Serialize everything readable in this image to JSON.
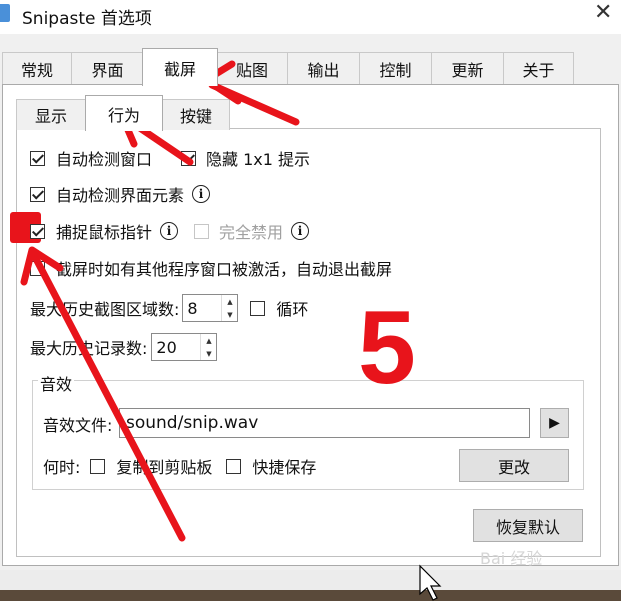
{
  "window": {
    "title": "Snipaste 首选项",
    "close_glyph": "✕"
  },
  "tabs": [
    "常规",
    "界面",
    "截屏",
    "贴图",
    "输出",
    "控制",
    "更新",
    "关于"
  ],
  "active_tab": "截屏",
  "subtabs": [
    "显示",
    "行为",
    "按键"
  ],
  "active_subtab": "行为",
  "options": {
    "auto_detect_window": {
      "label": "自动检测窗口",
      "checked": true
    },
    "hide_1x1_hint": {
      "label": "隐藏 1x1 提示",
      "checked": true
    },
    "auto_detect_elements": {
      "label": "自动检测界面元素",
      "checked": true
    },
    "capture_cursor": {
      "label": "捕捉鼠标指针",
      "checked": true
    },
    "disable_completely": {
      "label": "完全禁用",
      "checked": false,
      "disabled": true
    },
    "auto_exit": {
      "label": "截屏时如有其他程序窗口被激活，自动退出截屏",
      "checked": false
    },
    "max_history_regions": {
      "label": "最大历史截图区域数:",
      "value": "8"
    },
    "loop": {
      "label": "循环",
      "checked": false
    },
    "max_history_records": {
      "label": "最大历史记录数:",
      "value": "20"
    }
  },
  "info_glyph": "i",
  "sound": {
    "group_title": "音效",
    "file_label": "音效文件:",
    "file_value": "sound/snip.wav",
    "when_label": "何时:",
    "copy_clipboard": {
      "label": "复制到剪贴板",
      "checked": false
    },
    "quick_save": {
      "label": "快捷保存",
      "checked": false
    },
    "change_button": "更改",
    "play_glyph": "▶"
  },
  "restore_default_button": "恢复默认",
  "annotation": {
    "number": "5",
    "color": "#e8141b"
  },
  "watermark": "Bai 经验"
}
